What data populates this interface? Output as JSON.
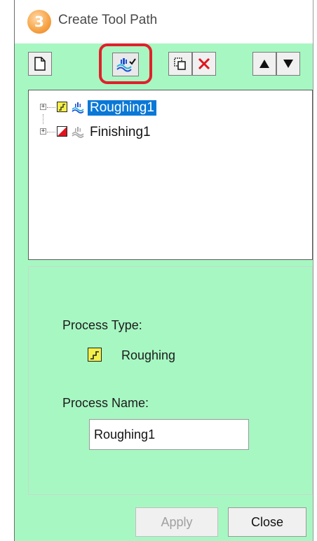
{
  "window": {
    "title": "Create Tool Path"
  },
  "toolbar": {
    "buttons": [
      {
        "id": "new",
        "icon": "new-document-icon"
      },
      {
        "id": "toolpath",
        "icon": "toolpath-icon",
        "highlighted": true
      },
      {
        "id": "copy",
        "icon": "copy-icon"
      },
      {
        "id": "delete",
        "icon": "delete-x-icon"
      },
      {
        "id": "move-up",
        "icon": "triangle-up-icon"
      },
      {
        "id": "move-down",
        "icon": "triangle-down-icon"
      }
    ]
  },
  "tree": {
    "items": [
      {
        "label": "Roughing1",
        "type": "roughing",
        "selected": true
      },
      {
        "label": "Finishing1",
        "type": "finishing",
        "selected": false
      }
    ]
  },
  "details": {
    "process_type_label": "Process Type:",
    "process_type_value": "Roughing",
    "process_name_label": "Process Name:",
    "process_name_value": "Roughing1"
  },
  "footer": {
    "apply_label": "Apply",
    "close_label": "Close"
  },
  "colors": {
    "panel_bg": "#a7f7c2",
    "selection": "#0a78d7",
    "highlight_ring": "#e0212b"
  }
}
